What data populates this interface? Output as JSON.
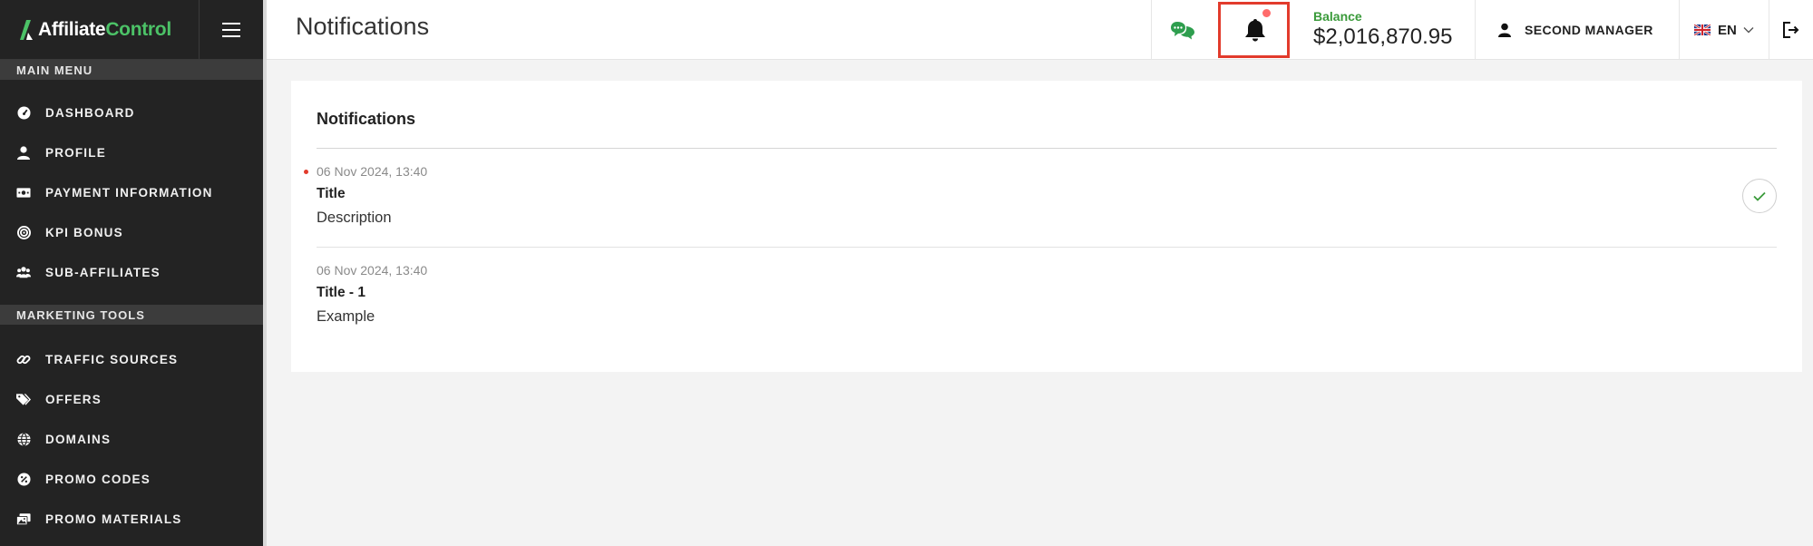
{
  "brand": {
    "name_part1": "Affiliate",
    "name_part2": "Control",
    "accent_color": "#4cc267"
  },
  "sidebar": {
    "sections": [
      {
        "title": "MAIN MENU",
        "items": [
          {
            "label": "DASHBOARD",
            "icon": "dashboard-icon"
          },
          {
            "label": "PROFILE",
            "icon": "user-icon"
          },
          {
            "label": "PAYMENT INFORMATION",
            "icon": "money-icon"
          },
          {
            "label": "KPI BONUS",
            "icon": "target-icon"
          },
          {
            "label": "SUB-AFFILIATES",
            "icon": "users-icon"
          }
        ]
      },
      {
        "title": "MARKETING TOOLS",
        "items": [
          {
            "label": "TRAFFIC SOURCES",
            "icon": "link-icon"
          },
          {
            "label": "OFFERS",
            "icon": "tags-icon"
          },
          {
            "label": "DOMAINS",
            "icon": "globe-icon"
          },
          {
            "label": "PROMO CODES",
            "icon": "promo-code-icon"
          },
          {
            "label": "PROMO MATERIALS",
            "icon": "images-icon"
          }
        ]
      }
    ]
  },
  "header": {
    "title": "Notifications",
    "balance_label": "Balance",
    "balance_value": "$2,016,870.95",
    "user_name": "SECOND MANAGER",
    "language": "EN"
  },
  "notifications": {
    "heading": "Notifications",
    "items": [
      {
        "date": "06 Nov 2024, 13:40",
        "title": "Title",
        "description": "Description",
        "unread": true
      },
      {
        "date": "06 Nov 2024, 13:40",
        "title": "Title - 1",
        "description": "Example",
        "unread": false
      }
    ]
  },
  "colors": {
    "sidebar_bg": "#232323",
    "highlight_frame": "#e23b2c",
    "balance_label": "#3a9a3a",
    "chat_icon": "#2e9e4e"
  }
}
